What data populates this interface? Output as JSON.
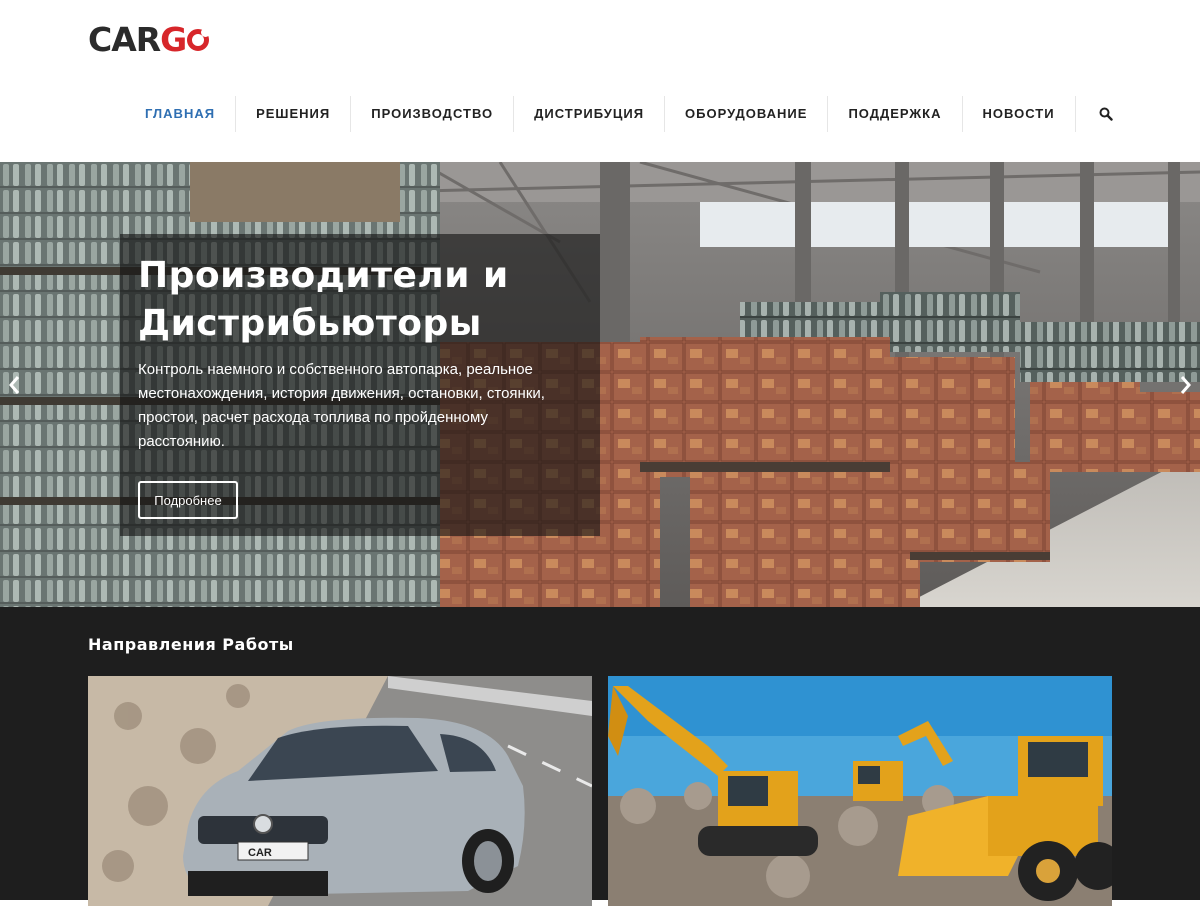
{
  "brand": {
    "logo_text_dark": "CAR",
    "logo_text_red": "G"
  },
  "nav": {
    "items": [
      {
        "label": "ГЛАВНАЯ",
        "active": true
      },
      {
        "label": "РЕШЕНИЯ"
      },
      {
        "label": "ПРОИЗВОДСТВО"
      },
      {
        "label": "ДИСТРИБУЦИЯ"
      },
      {
        "label": "ОБОРУДОВАНИЕ"
      },
      {
        "label": "ПОДДЕРЖКА"
      },
      {
        "label": "НОВОСТИ"
      }
    ],
    "search_icon": "search-icon"
  },
  "hero": {
    "title": "Производители и Дистрибьюторы",
    "text": "Контроль наемного и собственного автопарка, реальное местонахождения, история движения, остановки, стоянки, простои, расчет расхода топлива по пройденному расстоянию.",
    "button_label": "Подробнее",
    "prev_icon": "chevron-left-icon",
    "next_icon": "chevron-right-icon"
  },
  "directions": {
    "title": "Направления Работы",
    "car_plate": "CAR"
  },
  "colors": {
    "accent": "#2f6fb2",
    "brand_red": "#d7262a",
    "dark_section": "#1e1e1e"
  }
}
